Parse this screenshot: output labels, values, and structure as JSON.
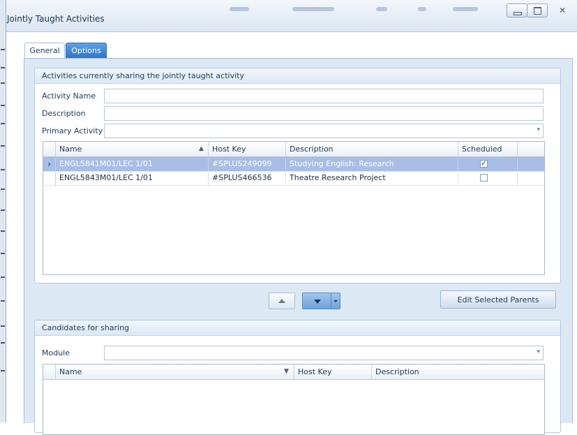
{
  "window": {
    "title": "Jointly Taught Activities"
  },
  "tabs": [
    {
      "label": "General",
      "active": true
    },
    {
      "label": "Options",
      "active": false
    }
  ],
  "sharing_group": {
    "title": "Activities currently sharing the jointly taught activity",
    "fields": {
      "activity_name": {
        "label": "Activity Name",
        "value": ""
      },
      "description": {
        "label": "Description",
        "value": ""
      },
      "primary_activity": {
        "label": "Primary Activity",
        "value": ""
      }
    },
    "grid": {
      "columns": [
        "Name",
        "Host Key",
        "Description",
        "Scheduled"
      ],
      "sort": {
        "column": "Name",
        "direction": "ascending"
      },
      "rows": [
        {
          "name": "ENGL5841M01/LEC 1/01",
          "host_key": "#SPLUS249099",
          "description": "Studying English: Research",
          "scheduled": true,
          "selected": true
        },
        {
          "name": "ENGL5843M01/LEC 1/01",
          "host_key": "#SPLUS466536",
          "description": "Theatre Research Project",
          "scheduled": false,
          "selected": false
        }
      ]
    }
  },
  "actions": {
    "move_up_icon": "arrow-up",
    "move_down_icon": "arrow-down",
    "edit_parents_label": "Edit Selected Parents"
  },
  "candidates_group": {
    "title": "Candidates for sharing",
    "module": {
      "label": "Module",
      "value": ""
    },
    "grid": {
      "columns": [
        "Name",
        "Host Key",
        "Description"
      ],
      "sort": {
        "column": "Name",
        "direction": "descending"
      },
      "rows": []
    }
  },
  "colors": {
    "accent": "#2f74c9",
    "selection": "#a7bee6",
    "panel": "#dde8f5"
  }
}
